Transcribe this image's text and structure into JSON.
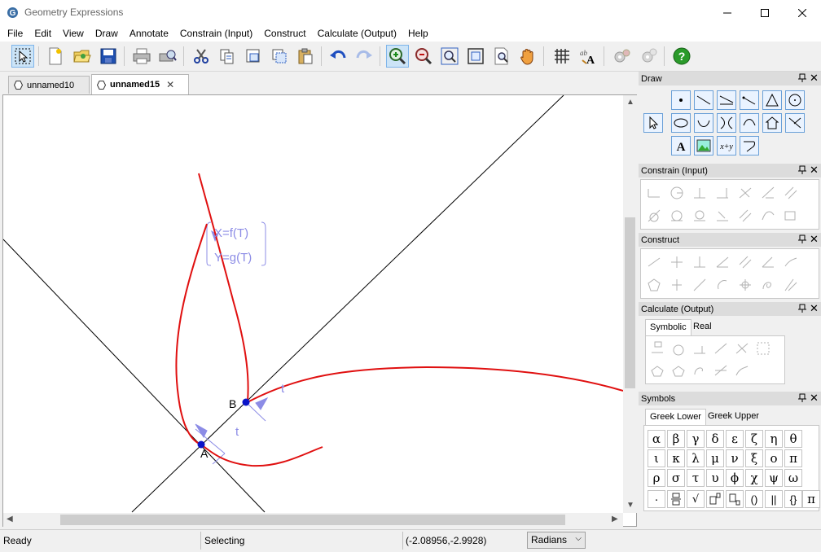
{
  "window": {
    "title": "Geometry Expressions",
    "controls": {
      "minimize": "minimize",
      "maximize": "maximize",
      "close": "close"
    }
  },
  "menu": [
    "File",
    "Edit",
    "View",
    "Draw",
    "Annotate",
    "Constrain (Input)",
    "Construct",
    "Calculate (Output)",
    "Help"
  ],
  "toolbar": {
    "tools": [
      "select-arrow-icon",
      "new-file-icon",
      "open-folder-icon",
      "save-disk-icon",
      "print-icon",
      "print-preview-icon",
      "cut-scissors-icon",
      "copy-icon",
      "copy-drawing-icon",
      "copy-frame-icon",
      "paste-icon",
      "undo-icon",
      "redo-icon",
      "zoom-in-icon",
      "zoom-out-icon",
      "zoom-fit-icon",
      "zoom-window-icon",
      "zoom-page-icon",
      "pan-hand-icon",
      "grid-icon",
      "font-style-icon",
      "gears-icon",
      "gears-alt-icon",
      "help-icon"
    ],
    "active": "zoom-in-icon"
  },
  "tabs": [
    {
      "label": "unnamed10",
      "active": false
    },
    {
      "label": "unnamed15",
      "active": true
    }
  ],
  "canvas": {
    "point_a": "A",
    "point_b": "B",
    "param_a": "t",
    "param_b": "t",
    "parametric": {
      "x_eq": "X=f(T)",
      "y_eq": "Y=g(T)"
    },
    "colors": {
      "curve": "#e01010",
      "point": "#0a14c8",
      "line": "#000000",
      "symbolic": "#8c8ce6"
    }
  },
  "panels": {
    "draw": {
      "title": "Draw"
    },
    "constrain": {
      "title": "Constrain (Input)"
    },
    "construct": {
      "title": "Construct"
    },
    "calculate": {
      "title": "Calculate (Output)",
      "tabs": [
        "Symbolic",
        "Real"
      ]
    },
    "symbols": {
      "title": "Symbols",
      "tabs": [
        "Greek Lower",
        "Greek Upper"
      ],
      "rows": [
        [
          "α",
          "β",
          "γ",
          "δ",
          "ε",
          "ζ",
          "η",
          "θ"
        ],
        [
          "ι",
          "κ",
          "λ",
          "μ",
          "ν",
          "ξ",
          "ο",
          "π"
        ],
        [
          "ρ",
          "σ",
          "τ",
          "υ",
          "ϕ",
          "χ",
          "ψ",
          "ω"
        ]
      ],
      "ops": [
        "·",
        "",
        "√",
        "",
        "",
        "()",
        "||",
        "{}",
        "π"
      ]
    }
  },
  "status": {
    "ready": "Ready",
    "mode": "Selecting",
    "coords": "(-2.08956,-2.9928)",
    "angle_unit": "Radians"
  }
}
